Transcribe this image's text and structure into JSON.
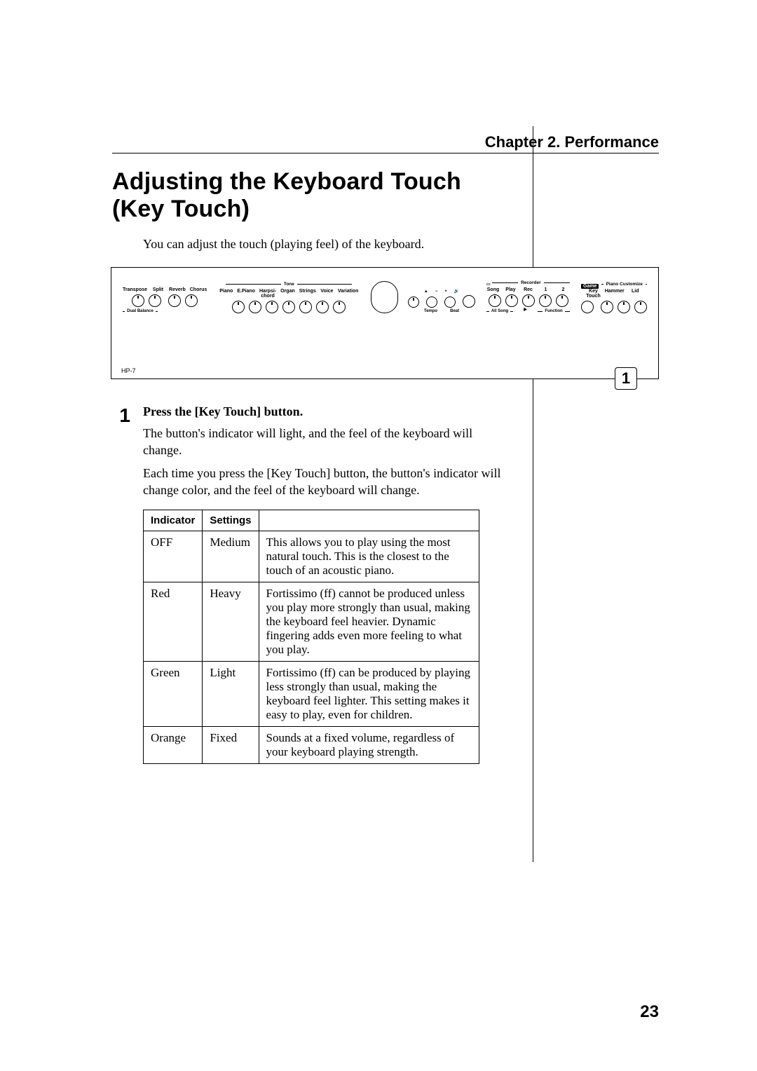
{
  "chapter": "Chapter 2. Performance",
  "title": "Adjusting the Keyboard Touch (Key Touch)",
  "intro": "You can adjust the touch (playing feel) of the keyboard.",
  "panel": {
    "model": "HP-7",
    "callout_number": "1",
    "left_group": {
      "buttons": [
        "Transpose",
        "Split",
        "Reverb",
        "Chorus"
      ],
      "under_label": "Dual Balance"
    },
    "tone_group": {
      "header": "Tone",
      "buttons": [
        "Piano",
        "E.Piano",
        "Harpsi-\nchord",
        "Organ",
        "Strings",
        "Voice",
        "Variation"
      ]
    },
    "metronome": {
      "title": "",
      "minus": "−",
      "plus": "+",
      "tempo": "Tempo",
      "beat": "Beat"
    },
    "recorder_group": {
      "header": "Recorder",
      "buttons": [
        "Song",
        "Play",
        "Rec",
        "1",
        "2"
      ],
      "under_label_left": "All Song",
      "under_label_right": "Function",
      "metronome_icon": "metronome-icon",
      "play_icon": "▶"
    },
    "customize_group": {
      "header": "Piano Customize",
      "game": "Game",
      "buttons": [
        "Key\nTouch",
        "Hammer",
        "Lid"
      ]
    }
  },
  "step": {
    "number": "1",
    "title": "Press the [Key Touch] button.",
    "p1": "The button's indicator will light, and the feel of the keyboard will change.",
    "p2": "Each time you press the [Key Touch] button, the button's indicator will change color, and the feel of the keyboard will change."
  },
  "table": {
    "headers": [
      "Indicator",
      "Settings",
      ""
    ],
    "rows": [
      {
        "indicator": "OFF",
        "setting": "Medium",
        "desc": "This allows you to play using the most natural touch. This is the closest to the touch of an acoustic piano."
      },
      {
        "indicator": "Red",
        "setting": "Heavy",
        "desc": "Fortissimo (ff) cannot be produced unless you play more strongly than usual, making the keyboard feel heavier. Dynamic fingering adds even more feeling to what you play."
      },
      {
        "indicator": "Green",
        "setting": "Light",
        "desc": "Fortissimo (ff) can be produced by playing less strongly than usual, making the keyboard feel lighter. This setting makes it easy to play, even for children."
      },
      {
        "indicator": "Orange",
        "setting": "Fixed",
        "desc": "Sounds at a fixed volume, regardless of your keyboard playing strength."
      }
    ]
  },
  "page_number": "23"
}
